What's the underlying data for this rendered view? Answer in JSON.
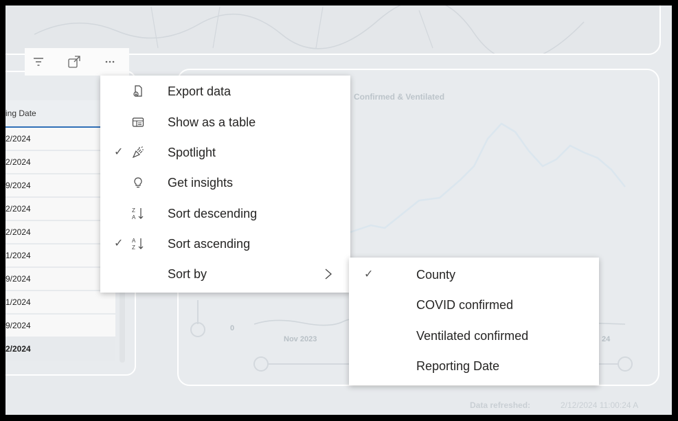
{
  "visual_header": {
    "icons": [
      "filter-icon",
      "focus-mode-icon",
      "more-options-icon"
    ]
  },
  "table": {
    "header": "ing Date",
    "rows": [
      "2/2024",
      "2/2024",
      "9/2024",
      "2/2024",
      "2/2024",
      "1/2024",
      "9/2024",
      "1/2024",
      "9/2024"
    ],
    "total": "2/2024"
  },
  "chart": {
    "title": "Confirmed & Ventilated",
    "zero_tick": "0",
    "x_tick": "Nov 2023",
    "x_tick_right": "24"
  },
  "context_menu": {
    "items": [
      {
        "label": "Export data",
        "icon": "export-data-icon",
        "checked": false
      },
      {
        "label": "Show as a table",
        "icon": "table-icon",
        "checked": false
      },
      {
        "label": "Spotlight",
        "icon": "spotlight-icon",
        "checked": true
      },
      {
        "label": "Get insights",
        "icon": "lightbulb-icon",
        "checked": false
      },
      {
        "label": "Sort descending",
        "icon": "sort-descending-icon",
        "checked": false
      },
      {
        "label": "Sort ascending",
        "icon": "sort-ascending-icon",
        "checked": true
      },
      {
        "label": "Sort by",
        "icon": "",
        "checked": false,
        "submenu": true
      }
    ],
    "check_glyph": "✓"
  },
  "sort_by_menu": {
    "items": [
      {
        "label": "County",
        "checked": true
      },
      {
        "label": "COVID confirmed",
        "checked": false
      },
      {
        "label": "Ventilated confirmed",
        "checked": false
      },
      {
        "label": "Reporting Date",
        "checked": false
      }
    ]
  },
  "footer": {
    "refreshed_label": "Data refreshed:",
    "refreshed_value": "2/12/2024 11:00:24 A"
  }
}
